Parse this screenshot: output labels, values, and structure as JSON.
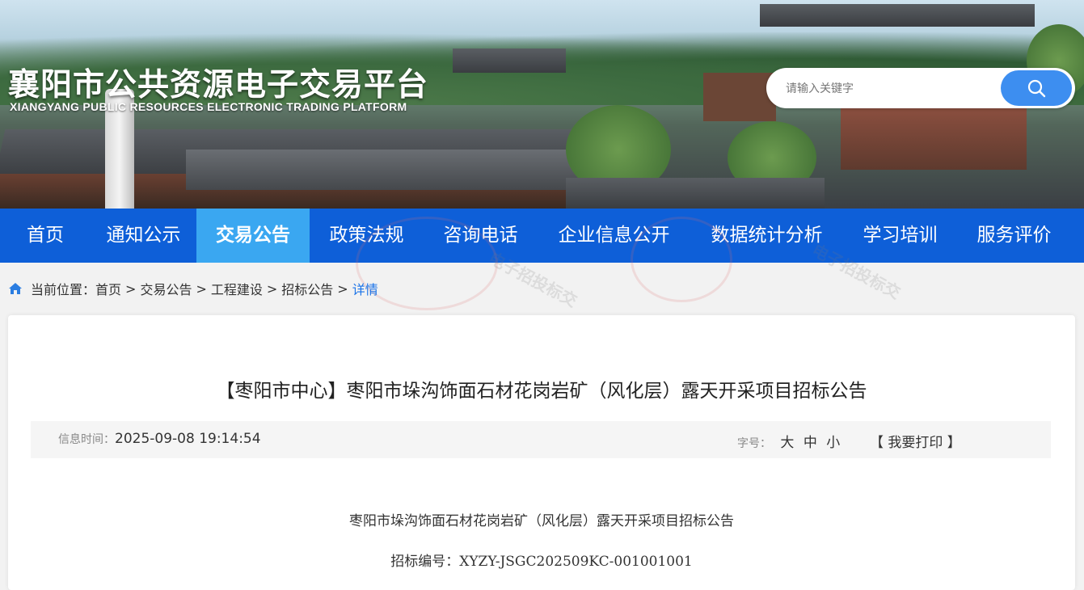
{
  "header": {
    "title": "襄阳市公共资源电子交易平台",
    "subtitle": "XIANGYANG PUBLIC RESOURCES ELECTRONIC TRADING PLATFORM",
    "search_placeholder": "请输入关键字",
    "search_icon": "search-icon"
  },
  "nav": {
    "items": [
      "首页",
      "通知公示",
      "交易公告",
      "政策法规",
      "咨询电话",
      "企业信息公开",
      "数据统计分析",
      "学习培训",
      "服务评价"
    ],
    "active": "交易公告",
    "bar_color": "#0e5fd8",
    "active_color": "#3aa7f1"
  },
  "breadcrumb": {
    "icon": "home-icon",
    "prefix": "当前位置：",
    "items": [
      "首页",
      "交易公告",
      "工程建设",
      "招标公告",
      "详情"
    ],
    "separator": ">"
  },
  "article": {
    "title": "【枣阳市中心】枣阳市垛沟饰面石材花岗岩矿（风化层）露天开采项目招标公告",
    "time_label": "信息时间：",
    "time_value": "2025-09-08 19:14:54",
    "font_label": "字号：",
    "font_options": [
      "大",
      "中",
      "小"
    ],
    "print_label": "【 我要打印 】",
    "body": [
      "枣阳市垛沟饰面石材花岗岩矿（风化层）露天开采项目招标公告",
      "招标编号：XYZY-JSGC202509KC-001001001"
    ]
  },
  "watermark": {
    "text": "电子招投标交"
  }
}
